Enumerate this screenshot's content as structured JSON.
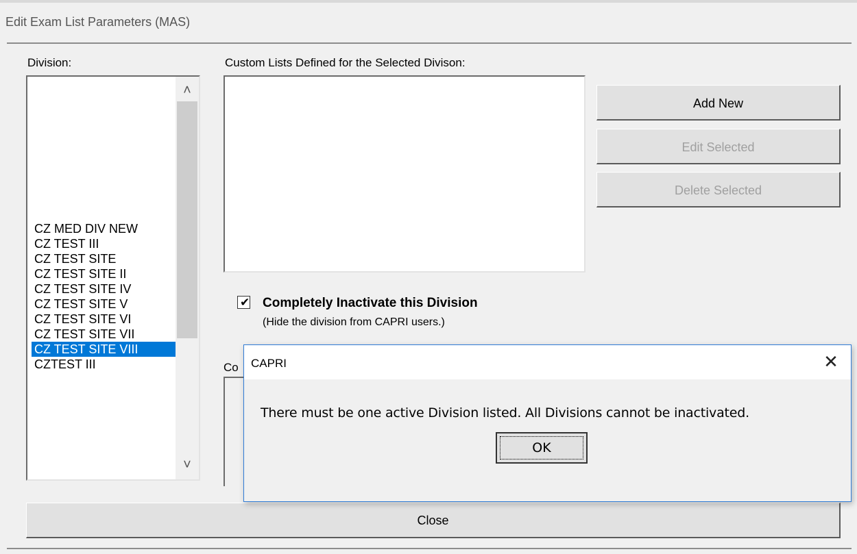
{
  "window": {
    "title": "Edit Exam List Parameters (MAS)"
  },
  "division": {
    "label": "Division:",
    "items": [
      "CZ MED DIV NEW",
      "CZ TEST III",
      "CZ TEST SITE",
      "CZ TEST SITE II",
      "CZ TEST SITE IV",
      "CZ TEST SITE V",
      "CZ TEST SITE VI",
      "CZ TEST SITE VII",
      "CZ TEST SITE VIII",
      "CZTEST III"
    ],
    "selected_index": 8
  },
  "custom_lists": {
    "label": "Custom Lists Defined for the Selected Divison:",
    "items": []
  },
  "buttons": {
    "add_new": "Add New",
    "edit_selected": "Edit Selected",
    "delete_selected": "Delete Selected",
    "close": "Close"
  },
  "inactivate": {
    "checked": true,
    "label": "Completely Inactivate this Division",
    "note": "(Hide the division from CAPRI users.)"
  },
  "lower_section": {
    "label_fragment": "Co"
  },
  "dialog": {
    "title": "CAPRI",
    "message": "There must be one active Division listed. All Divisions cannot be inactivated.",
    "ok_label": "OK",
    "close_glyph": "✕"
  },
  "icons": {
    "scroll_up": "chevron-up-icon",
    "scroll_down": "chevron-down-icon",
    "check": "check-icon",
    "close": "close-icon"
  },
  "colors": {
    "selection": "#0078d7",
    "dialog_border": "#2f7bd6",
    "disabled_text": "#a0a0a0"
  }
}
